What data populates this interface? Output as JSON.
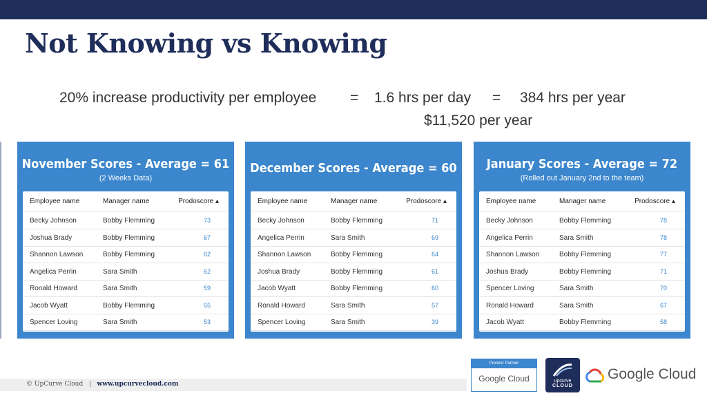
{
  "slide": {
    "title": "Not Knowing vs Knowing",
    "equation": {
      "part1": "20% increase productivity per employee",
      "eq1": "=",
      "part2": "1.6 hrs per day",
      "eq2": "=",
      "part3": "384 hrs per year",
      "line2": "$11,520 per year"
    }
  },
  "panels": [
    {
      "title": "November Scores - Average = 61",
      "subtitle": "(2 Weeks Data)",
      "headers": [
        "Employee name",
        "Manager name",
        "Prodoscore ▴"
      ],
      "rows": [
        [
          "Becky Johnson",
          "Bobby Flemming",
          "73"
        ],
        [
          "Joshua Brady",
          "Bobby Flemming",
          "67"
        ],
        [
          "Shannon Lawson",
          "Bobby Flemming",
          "62"
        ],
        [
          "Angelica Perrin",
          "Sara Smith",
          "62"
        ],
        [
          "Ronald Howard",
          "Sara Smith",
          "59"
        ],
        [
          "Jacob Wyatt",
          "Bobby Flemming",
          "55"
        ],
        [
          "Spencer Loving",
          "Sara Smith",
          "53"
        ]
      ]
    },
    {
      "title": "December Scores - Average = 60",
      "subtitle": "",
      "headers": [
        "Employee name",
        "Manager name",
        "Prodoscore ▴"
      ],
      "rows": [
        [
          "Becky Johnson",
          "Bobby Flemming",
          "71"
        ],
        [
          "Angelica Perrin",
          "Sara Smith",
          "69"
        ],
        [
          "Shannon Lawson",
          "Bobby Flemming",
          "64"
        ],
        [
          "Joshua Brady",
          "Bobby Flemming",
          "61"
        ],
        [
          "Jacob Wyatt",
          "Bobby Flemming",
          "60"
        ],
        [
          "Ronald Howard",
          "Sara Smith",
          "57"
        ],
        [
          "Spencer Loving",
          "Sara Smith",
          "39"
        ]
      ]
    },
    {
      "title": "January Scores - Average = 72",
      "subtitle": "(Rolled out January 2nd to the team)",
      "headers": [
        "Employee name",
        "Manager name",
        "Prodoscore ▴"
      ],
      "rows": [
        [
          "Becky Johnson",
          "Bobby Flemming",
          "78"
        ],
        [
          "Angelica Perrin",
          "Sara Smith",
          "78"
        ],
        [
          "Shannon Lawson",
          "Bobby Flemming",
          "77"
        ],
        [
          "Joshua Brady",
          "Bobby Flemming",
          "71"
        ],
        [
          "Spencer Loving",
          "Sara Smith",
          "70"
        ],
        [
          "Ronald Howard",
          "Sara Smith",
          "67"
        ],
        [
          "Jacob Wyatt",
          "Bobby Flemming",
          "58"
        ]
      ]
    }
  ],
  "footer": {
    "copyright": "© UpCurve Cloud",
    "separator": "|",
    "url": "www.upcurvecloud.com"
  },
  "logos": {
    "badge_top": "Premier Partner",
    "badge_bottom": "Google Cloud",
    "upcurve_line1": "upcurve",
    "upcurve_line2": "CLOUD",
    "google_cloud": "Google Cloud"
  },
  "colors": {
    "navy": "#1f2d5a",
    "panel_blue": "#3b86cc",
    "score_blue": "#3b86cc"
  }
}
